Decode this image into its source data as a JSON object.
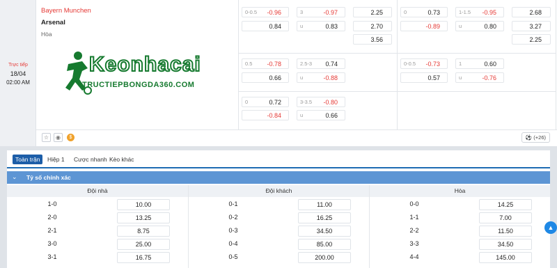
{
  "match": {
    "status": "Trực tiếp",
    "date": "18/04",
    "time": "02:00 AM",
    "home": "Bayern Munchen",
    "away": "Arsenal",
    "draw": "Hòa",
    "more_markets": "(+26)"
  },
  "logo": {
    "name": "Keonhacai",
    "site": "TRUCTIEPBONGDA360.COM"
  },
  "odds_rows": [
    {
      "full_hdp": [
        {
          "hd": "0-0.5",
          "v": "-0.96"
        },
        {
          "hd": "",
          "v": "0.84"
        }
      ],
      "full_ou": [
        {
          "hd": "3",
          "v": "-0.97"
        },
        {
          "hd": "u",
          "v": "0.83"
        }
      ],
      "full_1x2": [
        "2.25",
        "2.70",
        "3.56"
      ],
      "half_hdp": [
        {
          "hd": "0",
          "v": "0.73"
        },
        {
          "hd": "",
          "v": "-0.89"
        }
      ],
      "half_ou": [
        {
          "hd": "1-1.5",
          "v": "-0.95"
        },
        {
          "hd": "u",
          "v": "0.80"
        }
      ],
      "half_1x2": [
        "2.68",
        "3.27",
        "2.25"
      ]
    },
    {
      "full_hdp": [
        {
          "hd": "0.5",
          "v": "-0.78"
        },
        {
          "hd": "",
          "v": "0.66"
        }
      ],
      "full_ou": [
        {
          "hd": "2.5-3",
          "v": "0.74"
        },
        {
          "hd": "u",
          "v": "-0.88"
        }
      ],
      "half_hdp": [
        {
          "hd": "0-0.5",
          "v": "-0.73"
        },
        {
          "hd": "",
          "v": "0.57"
        }
      ],
      "half_ou": [
        {
          "hd": "1",
          "v": "0.60"
        },
        {
          "hd": "u",
          "v": "-0.76"
        }
      ]
    },
    {
      "full_hdp": [
        {
          "hd": "0",
          "v": "0.72"
        },
        {
          "hd": "",
          "v": "-0.84"
        }
      ],
      "full_ou": [
        {
          "hd": "3-3.5",
          "v": "-0.80"
        },
        {
          "hd": "u",
          "v": "0.66"
        }
      ]
    }
  ],
  "tabs": [
    "Toàn trận",
    "Hiệp 1",
    "Cược nhanh",
    "Kèo khác"
  ],
  "section": {
    "title": "Tỷ số chính xác",
    "columns": [
      "Đội nhà",
      "Đội khách",
      "Hòa"
    ]
  },
  "scores": {
    "home": [
      [
        "1-0",
        "10.00"
      ],
      [
        "2-0",
        "13.25"
      ],
      [
        "2-1",
        "8.75"
      ],
      [
        "3-0",
        "25.00"
      ],
      [
        "3-1",
        "16.75"
      ]
    ],
    "away": [
      [
        "0-1",
        "11.00"
      ],
      [
        "0-2",
        "16.25"
      ],
      [
        "0-3",
        "34.50"
      ],
      [
        "0-4",
        "85.00"
      ],
      [
        "0-5",
        "200.00"
      ]
    ],
    "draw": [
      [
        "0-0",
        "14.25"
      ],
      [
        "1-1",
        "7.00"
      ],
      [
        "2-2",
        "11.50"
      ],
      [
        "3-3",
        "34.50"
      ],
      [
        "4-4",
        "145.00"
      ]
    ]
  },
  "icons": [
    "star-icon",
    "eye-icon",
    "coin-icon",
    "soccer-ball-icon",
    "chevron-down-icon",
    "arrow-up-icon"
  ],
  "colors": {
    "accent_blue": "#1d5ea8",
    "section_blue": "#5d95d4",
    "negative_red": "#e53935",
    "logo_green": "#167a2f"
  }
}
